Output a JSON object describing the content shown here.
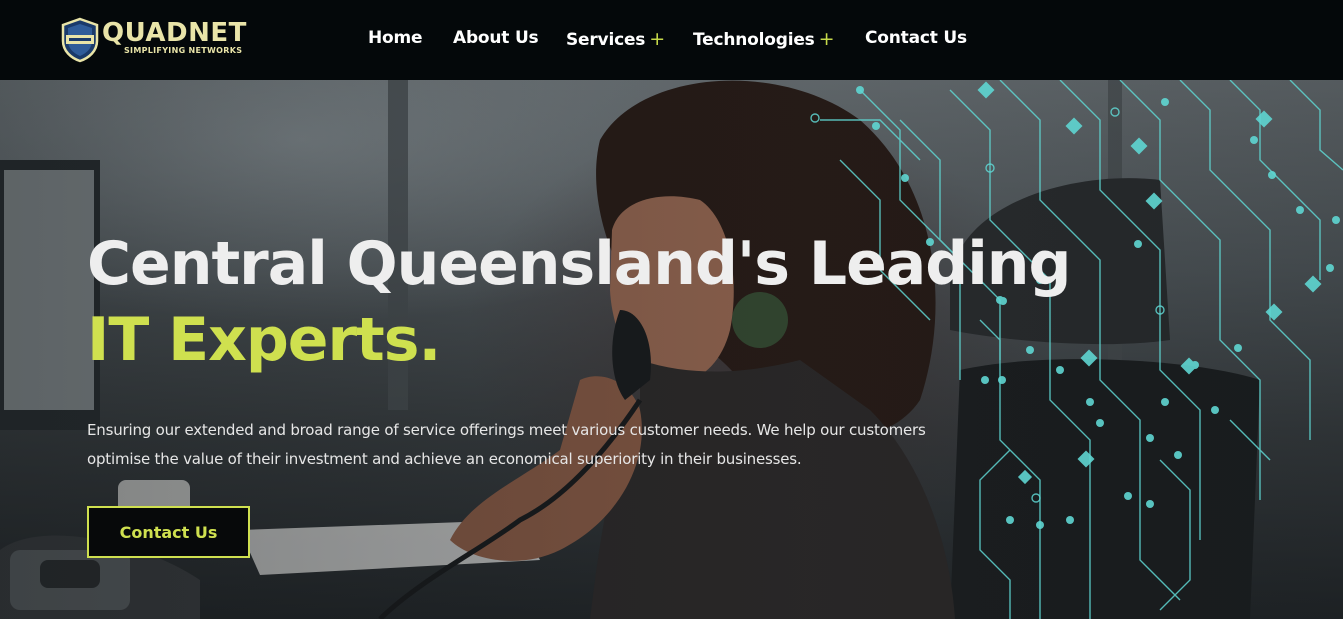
{
  "brand": {
    "name": "QUADNET",
    "tagline": "SIMPLIFYING NETWORKS",
    "colors": {
      "accent": "#cfe04f",
      "header_bg": "#04080a",
      "circuit": "#5fd6d2"
    }
  },
  "nav": {
    "items": [
      {
        "label": "Home",
        "has_submenu": false
      },
      {
        "label": "About Us",
        "has_submenu": false
      },
      {
        "label": "Services",
        "has_submenu": true
      },
      {
        "label": "Technologies",
        "has_submenu": true
      },
      {
        "label": "Contact Us",
        "has_submenu": false
      }
    ],
    "submenu_glyph": "+"
  },
  "hero": {
    "headline_line1": "Central Queensland's Leading",
    "headline_line2": "IT Experts.",
    "lead": "Ensuring our extended and broad range of service offerings meet various customer needs. We help our customers optimise the value of their investment and achieve an economical superiority in their businesses.",
    "cta_label": "Contact Us"
  },
  "icons": {
    "logo": "shield-logo-icon",
    "submenu": "plus-icon",
    "background": "woman-on-phone-photo",
    "decoration": "circuit-lines-graphic"
  }
}
